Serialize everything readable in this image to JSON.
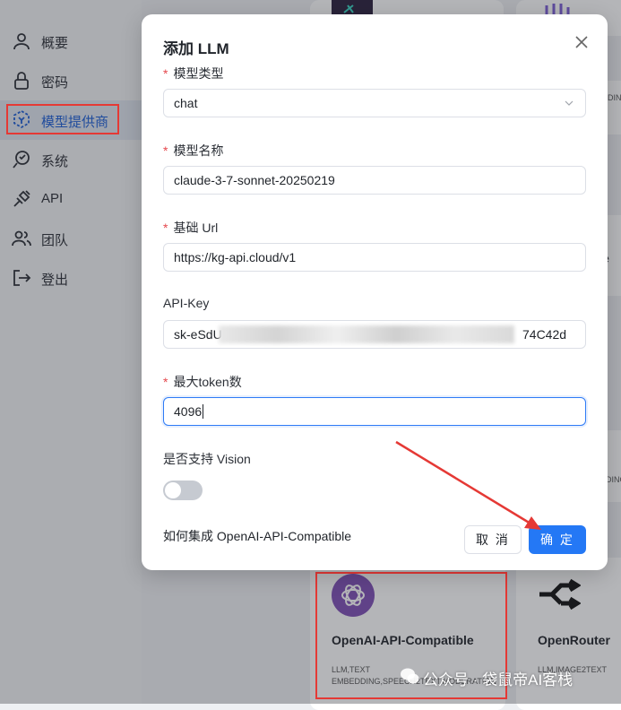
{
  "sidebar": {
    "items": [
      {
        "label": "概要",
        "icon": "user-icon"
      },
      {
        "label": "密码",
        "icon": "lock-icon"
      },
      {
        "label": "模型提供商",
        "icon": "model-provider-icon"
      },
      {
        "label": "系统",
        "icon": "system-icon"
      },
      {
        "label": "API",
        "icon": "plug-icon"
      },
      {
        "label": "团队",
        "icon": "team-icon"
      },
      {
        "label": "登出",
        "icon": "logout-icon"
      }
    ],
    "active_index": 2
  },
  "background_cards": {
    "openai_compatible": {
      "title": "OpenAI-API-Compatible",
      "tags_line1": "LLM,TEXT",
      "tags_line2": "EMBEDDING,SPEECH2TEXT,MODERATION"
    },
    "openrouter": {
      "title": "OpenRouter",
      "tags_line1": "LLM,IMAGE2TEXT"
    },
    "partial_text_1": "DING",
    "partial_text_2": "e",
    "partial_text_3": "DING,"
  },
  "watermark": {
    "text": "公众号 · 袋鼠帝AI客栈"
  },
  "dialog": {
    "title": "添加 LLM",
    "fields": {
      "model_type": {
        "label": "模型类型",
        "required": true,
        "value": "chat"
      },
      "model_name": {
        "label": "模型名称",
        "required": true,
        "value": "claude-3-7-sonnet-20250219"
      },
      "base_url": {
        "label": "基础 Url",
        "required": true,
        "value": "https://kg-api.cloud/v1"
      },
      "api_key": {
        "label": "API-Key",
        "required": false,
        "value_prefix": "sk-eSdU",
        "value_suffix": "74C42d"
      },
      "max_tokens": {
        "label": "最大token数",
        "required": true,
        "value": "4096"
      }
    },
    "vision": {
      "label": "是否支持 Vision",
      "enabled": false
    },
    "help_link": "如何集成 OpenAI-API-Compatible",
    "cancel_label": "取 消",
    "ok_label": "确 定",
    "required_mark": "*"
  },
  "colors": {
    "primary": "#2478f5",
    "active_text": "#1d5fd6",
    "annotation_red": "#e53935",
    "required": "#e5484d"
  }
}
